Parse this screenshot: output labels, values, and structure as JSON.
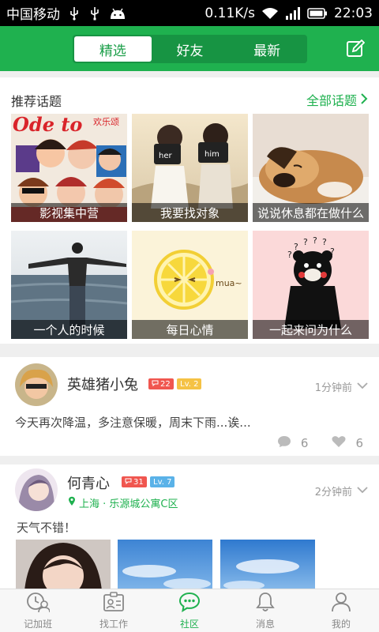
{
  "status_bar": {
    "carrier": "中国移动",
    "speed": "0.11K/s",
    "time": "22:03"
  },
  "header": {
    "tabs": [
      {
        "label": "精选",
        "active": true
      },
      {
        "label": "好友",
        "active": false
      },
      {
        "label": "最新",
        "active": false
      }
    ],
    "edit_icon": "edit-icon"
  },
  "topics": {
    "title": "推荐话题",
    "all_label": "全部话题",
    "tile_overlay_text": "欢乐颂",
    "items": [
      {
        "label": "影视集中营"
      },
      {
        "label": "我要找对象"
      },
      {
        "label": "说说休息都在做什么"
      },
      {
        "label": "一个人的时候"
      },
      {
        "label": "每日心情"
      },
      {
        "label": "一起来问为什么"
      }
    ]
  },
  "posts": [
    {
      "user": "英雄猪小兔",
      "badge_count": "22",
      "level": "Lv. 2",
      "time": "1分钟前",
      "text": "今天再次降温，多注意保暖，周末下雨...诶...",
      "comments": "6",
      "likes": "6"
    },
    {
      "user": "何青心",
      "badge_count": "31",
      "level": "Lv. 7",
      "time": "2分钟前",
      "location": "上海 · 乐源城公寓C区",
      "text": "天气不错！"
    }
  ],
  "tab_bar": [
    {
      "label": "记加班",
      "icon": "clock-user-icon",
      "active": false
    },
    {
      "label": "找工作",
      "icon": "id-card-icon",
      "active": false
    },
    {
      "label": "社区",
      "icon": "chat-bubble-icon",
      "active": true
    },
    {
      "label": "消息",
      "icon": "bell-icon",
      "active": false
    },
    {
      "label": "我的",
      "icon": "person-icon",
      "active": false
    }
  ],
  "colors": {
    "brand_green": "#1fb14f",
    "badge_red": "#f0564f",
    "badge_yellow": "#f5c245",
    "badge_blue": "#5ab2e8"
  }
}
